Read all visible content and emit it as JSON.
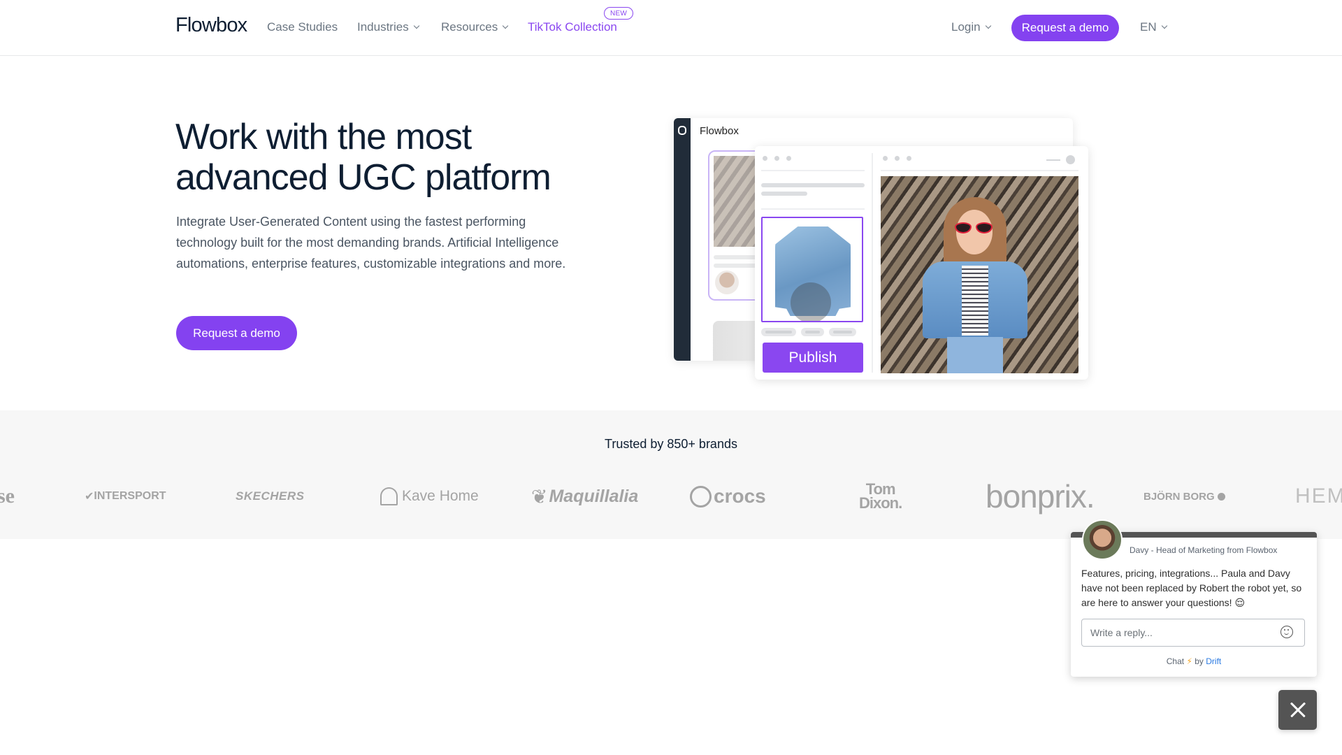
{
  "header": {
    "logo": "Flowbox",
    "nav": [
      {
        "label": "Case Studies",
        "has_dropdown": false
      },
      {
        "label": "Industries",
        "has_dropdown": true
      },
      {
        "label": "Resources",
        "has_dropdown": true
      },
      {
        "label": "TikTok Collection",
        "has_dropdown": false,
        "badge": "NEW"
      }
    ],
    "login_label": "Login",
    "demo_button": "Request a demo",
    "language": "EN"
  },
  "hero": {
    "title_line1": "Work with the most",
    "title_line2": "advanced UGC platform",
    "description": "Integrate User-Generated Content using the fastest performing technology built for the most demanding brands. Artificial Intelligence automations, enterprise features, customizable integrations and more.",
    "cta": "Request a demo",
    "mockup": {
      "app_name": "Flowbox",
      "publish_label": "Publish"
    }
  },
  "brands": {
    "title": "Trusted by 850+ brands",
    "logos": [
      {
        "name": "se",
        "text": "se"
      },
      {
        "name": "intersport",
        "text": "INTERSPORT"
      },
      {
        "name": "skechers",
        "text": "SKECHERS"
      },
      {
        "name": "kave-home",
        "text": "Kave Home"
      },
      {
        "name": "maquillalia",
        "text": "Maquillalia"
      },
      {
        "name": "crocs",
        "text": "crocs"
      },
      {
        "name": "tom-dixon",
        "text_line1": "Tom",
        "text_line2": "Dixon."
      },
      {
        "name": "bonprix",
        "text": "bonprix."
      },
      {
        "name": "bjorn-borg",
        "text": "BJÖRN BORG"
      },
      {
        "name": "hem",
        "text": "HEM"
      }
    ]
  },
  "chat": {
    "sender": "Davy - Head of Marketing from Flowbox",
    "message": "Features, pricing, integrations... Paula and Davy have not been replaced by Robert the robot yet, so are here to answer your questions! 😌",
    "input_placeholder": "Write a reply...",
    "footer_chat": "Chat",
    "footer_bolt": "⚡",
    "footer_by": "by",
    "footer_brand": "Drift"
  },
  "colors": {
    "accent": "#8442f0",
    "text_dark": "#0e1e32",
    "text_muted": "#6b7682",
    "band_bg": "#f7f7f7",
    "chat_dark": "#545454"
  }
}
